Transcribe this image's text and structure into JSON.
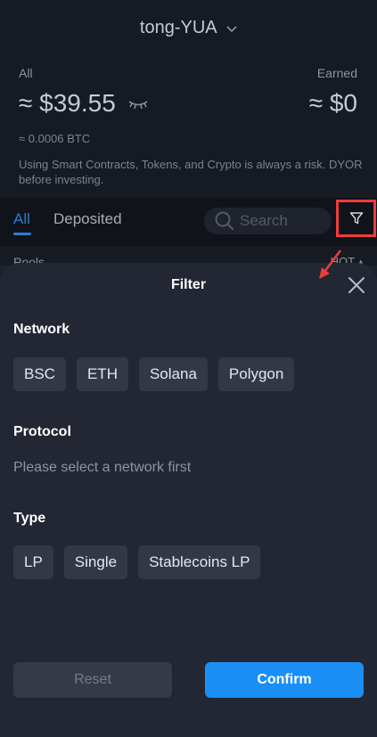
{
  "header": {
    "wallet_name": "tong-YUA",
    "all_label": "All",
    "earned_label": "Earned",
    "all_value": "≈ $39.55",
    "earned_value": "≈ $0",
    "btc_value": "≈ 0.0006 BTC",
    "warning": "Using Smart Contracts, Tokens, and Crypto is always a risk. DYOR before investing."
  },
  "tabs": {
    "all": "All",
    "deposited": "Deposited",
    "search_placeholder": "Search"
  },
  "list": {
    "pools_label": "Pools",
    "sort_label": "HOT ▴"
  },
  "filter": {
    "title": "Filter",
    "network": {
      "title": "Network",
      "options": [
        "BSC",
        "ETH",
        "Solana",
        "Polygon"
      ]
    },
    "protocol": {
      "title": "Protocol",
      "hint": "Please select a network first"
    },
    "type": {
      "title": "Type",
      "options": [
        "LP",
        "Single",
        "Stablecoins LP"
      ]
    },
    "reset_label": "Reset",
    "confirm_label": "Confirm"
  },
  "colors": {
    "accent": "#2d7bd8",
    "confirm": "#1a8ff5",
    "highlight": "#ef3b3b"
  }
}
